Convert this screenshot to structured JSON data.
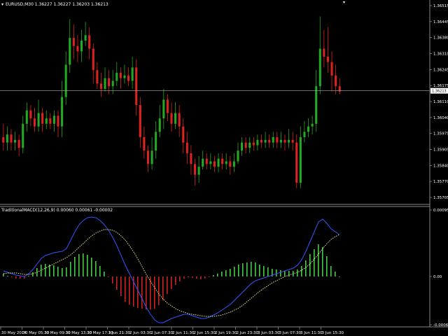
{
  "main_header": "EURUSD,M30  1.36227 1.36227 1.36203 1.36213",
  "sub_header": "TraditionalMACD(12,26,9) 0.00060 0.00061 -0.00002",
  "current_price_label": "1.36213",
  "price_axis_labels": [
    "1.36515",
    "1.36445",
    "1.36380",
    "1.36310",
    "1.36245",
    "1.36175",
    "1.36110",
    "1.36040",
    "1.35975",
    "1.35905",
    "1.35840",
    "1.35770",
    "1.35705"
  ],
  "macd_axis_labels": [
    "0.00095",
    "0.00",
    "-0.00069"
  ],
  "time_labels": [
    "30 May 2014",
    "30 May 05:30",
    "30 May 09:30",
    "30 May 13:30",
    "30 May 17:30",
    "1 Jun 21:30",
    "2 Jun 03:30",
    "2 Jun 07:30",
    "2 Jun 11:30",
    "2 Jun 15:30",
    "2 Jun 19:30",
    "2 Jun 23:30",
    "3 Jun 03:30",
    "3 Jun 07:30",
    "3 Jun 11:30",
    "3 Jun 15:30"
  ],
  "colors": {
    "background": "#000000",
    "bull": "#22aa22",
    "bear": "#dd2222",
    "hist_pos": "#44cc44",
    "hist_neg": "#cc2222",
    "macd_line": "#3355ff",
    "signal_line": "#ffff99",
    "grid": "#888888",
    "text": "#ffffff"
  },
  "chart_data": {
    "type": "candlestick",
    "symbol": "EURUSD",
    "timeframe": "M30",
    "ylim": [
      1.358,
      1.3652
    ],
    "candles": [
      [
        1.3604,
        1.3602,
        1.3609,
        1.3599
      ],
      [
        1.3602,
        1.3605,
        1.3608,
        1.3599
      ],
      [
        1.3605,
        1.3602,
        1.3607,
        1.3599
      ],
      [
        1.3602,
        1.3603,
        1.3606,
        1.3599
      ],
      [
        1.3603,
        1.36,
        1.3605,
        1.3597
      ],
      [
        1.36,
        1.3609,
        1.3612,
        1.3598
      ],
      [
        1.3609,
        1.3614,
        1.3617,
        1.3606
      ],
      [
        1.3614,
        1.3611,
        1.3616,
        1.3608
      ],
      [
        1.3611,
        1.3608,
        1.3615,
        1.3606
      ],
      [
        1.3608,
        1.3613,
        1.3618,
        1.3606
      ],
      [
        1.3613,
        1.3609,
        1.3615,
        1.3606
      ],
      [
        1.3609,
        1.3611,
        1.3614,
        1.3607
      ],
      [
        1.3611,
        1.3609,
        1.3613,
        1.3607
      ],
      [
        1.3609,
        1.3612,
        1.3614,
        1.3606
      ],
      [
        1.3612,
        1.3608,
        1.3614,
        1.3604
      ],
      [
        1.3608,
        1.3619,
        1.3625,
        1.3604
      ],
      [
        1.3619,
        1.3631,
        1.3636,
        1.3616
      ],
      [
        1.3631,
        1.3641,
        1.3648,
        1.3628
      ],
      [
        1.3641,
        1.3638,
        1.3646,
        1.3633
      ],
      [
        1.3638,
        1.3636,
        1.3642,
        1.3632
      ],
      [
        1.3636,
        1.364,
        1.3644,
        1.3632
      ],
      [
        1.364,
        1.3642,
        1.3647,
        1.3638
      ],
      [
        1.3642,
        1.3637,
        1.3645,
        1.3633
      ],
      [
        1.3637,
        1.3629,
        1.3639,
        1.3624
      ],
      [
        1.3629,
        1.3624,
        1.3632,
        1.3622
      ],
      [
        1.3624,
        1.3622,
        1.3628,
        1.3619
      ],
      [
        1.3622,
        1.3626,
        1.363,
        1.3621
      ],
      [
        1.3626,
        1.3623,
        1.3629,
        1.362
      ],
      [
        1.3623,
        1.3625,
        1.3629,
        1.362
      ],
      [
        1.3625,
        1.3628,
        1.3632,
        1.3623
      ],
      [
        1.3628,
        1.3626,
        1.363,
        1.3622
      ],
      [
        1.3626,
        1.3627,
        1.3631,
        1.3624
      ],
      [
        1.3627,
        1.3625,
        1.363,
        1.3623
      ],
      [
        1.3625,
        1.363,
        1.3634,
        1.3622
      ],
      [
        1.363,
        1.3616,
        1.3633,
        1.3612
      ],
      [
        1.3616,
        1.3604,
        1.3619,
        1.36
      ],
      [
        1.3604,
        1.3599,
        1.3608,
        1.3596
      ],
      [
        1.3599,
        1.3594,
        1.3601,
        1.3591
      ],
      [
        1.3594,
        1.3599,
        1.3604,
        1.3592
      ],
      [
        1.3599,
        1.3606,
        1.361,
        1.3596
      ],
      [
        1.3606,
        1.3611,
        1.3616,
        1.3604
      ],
      [
        1.3611,
        1.3618,
        1.3622,
        1.3607
      ],
      [
        1.3618,
        1.3613,
        1.362,
        1.361
      ],
      [
        1.3613,
        1.3609,
        1.3617,
        1.3606
      ],
      [
        1.3609,
        1.3613,
        1.3617,
        1.3607
      ],
      [
        1.3613,
        1.3608,
        1.3616,
        1.3604
      ],
      [
        1.3608,
        1.3602,
        1.3611,
        1.3598
      ],
      [
        1.3602,
        1.3598,
        1.3606,
        1.3594
      ],
      [
        1.3598,
        1.3594,
        1.3601,
        1.359
      ],
      [
        1.3594,
        1.359,
        1.3596,
        1.3586
      ],
      [
        1.359,
        1.3593,
        1.3597,
        1.3587
      ],
      [
        1.3593,
        1.3596,
        1.3599,
        1.3592
      ],
      [
        1.3596,
        1.3594,
        1.3598,
        1.3592
      ],
      [
        1.3594,
        1.3595,
        1.3598,
        1.3592
      ],
      [
        1.3595,
        1.3593,
        1.3597,
        1.3591
      ],
      [
        1.3593,
        1.3596,
        1.3598,
        1.3591
      ],
      [
        1.3596,
        1.3594,
        1.3598,
        1.3592
      ],
      [
        1.3594,
        1.3595,
        1.3598,
        1.3592
      ],
      [
        1.3595,
        1.3593,
        1.3597,
        1.359
      ],
      [
        1.3593,
        1.3595,
        1.3598,
        1.3591
      ],
      [
        1.3595,
        1.3599,
        1.3602,
        1.3594
      ],
      [
        1.3599,
        1.3602,
        1.3604,
        1.3597
      ],
      [
        1.3602,
        1.36,
        1.3604,
        1.3598
      ],
      [
        1.36,
        1.3602,
        1.3604,
        1.3598
      ],
      [
        1.3602,
        1.3601,
        1.3604,
        1.3599
      ],
      [
        1.3601,
        1.3603,
        1.3605,
        1.3599
      ],
      [
        1.3603,
        1.3602,
        1.3605,
        1.36
      ],
      [
        1.3602,
        1.3603,
        1.3606,
        1.36
      ],
      [
        1.3603,
        1.3602,
        1.3605,
        1.36
      ],
      [
        1.3602,
        1.3604,
        1.3606,
        1.36
      ],
      [
        1.3604,
        1.3602,
        1.3606,
        1.36
      ],
      [
        1.3602,
        1.3603,
        1.3606,
        1.36
      ],
      [
        1.3603,
        1.3602,
        1.3605,
        1.3599
      ],
      [
        1.3602,
        1.3603,
        1.3607,
        1.36
      ],
      [
        1.3603,
        1.3602,
        1.3606,
        1.3599
      ],
      [
        1.3602,
        1.3587,
        1.3605,
        1.3585
      ],
      [
        1.3587,
        1.3604,
        1.3608,
        1.3585
      ],
      [
        1.3604,
        1.3606,
        1.361,
        1.3602
      ],
      [
        1.3606,
        1.3608,
        1.3611,
        1.3604
      ],
      [
        1.3608,
        1.3609,
        1.3612,
        1.3605
      ],
      [
        1.3609,
        1.3623,
        1.3629,
        1.3606
      ],
      [
        1.3623,
        1.3637,
        1.3649,
        1.362
      ],
      [
        1.3637,
        1.3634,
        1.3644,
        1.363
      ],
      [
        1.3634,
        1.3632,
        1.3645,
        1.3628
      ],
      [
        1.3632,
        1.3627,
        1.3636,
        1.3621
      ],
      [
        1.3627,
        1.3623,
        1.3631,
        1.362
      ],
      [
        1.3623,
        1.3621,
        1.3626,
        1.362
      ]
    ],
    "macd": [
      8,
      6,
      4,
      2,
      1,
      0,
      4,
      10,
      18,
      26,
      30,
      32,
      34,
      35,
      36,
      40,
      52,
      64,
      74,
      80,
      84,
      85,
      84,
      80,
      74,
      66,
      56,
      44,
      30,
      16,
      4,
      -8,
      -20,
      -32,
      -44,
      -54,
      -62,
      -66,
      -66,
      -63,
      -60,
      -58,
      -56,
      -54,
      -54,
      -56,
      -58,
      -60,
      -60,
      -58,
      -55,
      -52,
      -48,
      -44,
      -40,
      -34,
      -28,
      -22,
      -16,
      -10,
      -6,
      -4,
      -2,
      0,
      2,
      4,
      6,
      8,
      10,
      12,
      16,
      24,
      36,
      50,
      64,
      78,
      82,
      76,
      68,
      64,
      60
    ],
    "signal": [
      4,
      5,
      5,
      5,
      4,
      3,
      3,
      4,
      6,
      9,
      12,
      15,
      18,
      21,
      24,
      27,
      31,
      36,
      42,
      47,
      53,
      58,
      62,
      65,
      67,
      67,
      66,
      63,
      58,
      52,
      44,
      35,
      25,
      14,
      3,
      -7,
      -16,
      -25,
      -32,
      -38,
      -42,
      -46,
      -49,
      -51,
      -53,
      -54,
      -55,
      -56,
      -57,
      -57,
      -57,
      -56,
      -55,
      -53,
      -51,
      -48,
      -45,
      -41,
      -36,
      -31,
      -26,
      -21,
      -17,
      -13,
      -9,
      -6,
      -3,
      0,
      2,
      4,
      6,
      9,
      13,
      18,
      25,
      32,
      40,
      47,
      53,
      57,
      60
    ],
    "histogram": [
      4,
      1,
      -1,
      -3,
      -3,
      -3,
      1,
      6,
      12,
      17,
      18,
      17,
      16,
      14,
      12,
      13,
      21,
      28,
      32,
      33,
      31,
      27,
      22,
      15,
      7,
      -1,
      -10,
      -19,
      -28,
      -36,
      -40,
      -43,
      -45,
      -46,
      -47,
      -47,
      -46,
      -41,
      -34,
      -25,
      -18,
      -12,
      -7,
      -3,
      -1,
      -2,
      -3,
      -4,
      -3,
      -1,
      2,
      4,
      7,
      9,
      11,
      14,
      17,
      19,
      20,
      21,
      20,
      17,
      15,
      13,
      11,
      10,
      9,
      8,
      8,
      8,
      10,
      15,
      23,
      32,
      39,
      46,
      42,
      29,
      15,
      7,
      0
    ]
  }
}
